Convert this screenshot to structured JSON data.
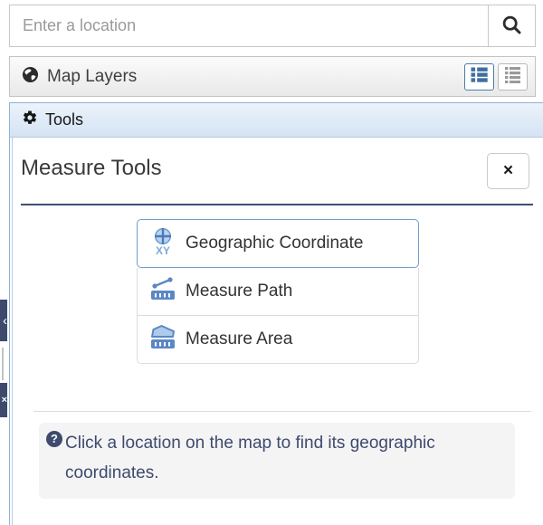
{
  "search": {
    "placeholder": "Enter a location"
  },
  "layers_header": {
    "title": "Map Layers",
    "icon": "globe-icon",
    "view_toggles": [
      {
        "name": "detailed-list-view",
        "icon": "list-detailed-icon",
        "active": true
      },
      {
        "name": "compact-list-view",
        "icon": "list-compact-icon",
        "active": false
      }
    ]
  },
  "tools_header": {
    "title": "Tools",
    "icon": "gear-icon"
  },
  "measure_panel": {
    "title": "Measure Tools",
    "close_glyph": "×",
    "tool_buttons": [
      {
        "label": "Geographic Coordinate",
        "icon": "geographic-coordinate-icon",
        "active": true
      },
      {
        "label": "Measure Path",
        "icon": "measure-path-icon",
        "active": false
      },
      {
        "label": "Measure Area",
        "icon": "measure-area-icon",
        "active": false
      }
    ],
    "help_text": "Click a location on the map to find its geographic coordinates.",
    "help_icon_glyph": "?"
  },
  "edge_controls": {
    "collapse_tab_glyph": "‹",
    "close_tab_glyph": "×"
  },
  "colors": {
    "accent_blue_border": "#4c7bab",
    "tool_icon_blue": "#5b87c5",
    "tool_icon_blue_light": "#aecbe9",
    "navy_text": "#3e4a6e",
    "hr_navy": "#3d4e77",
    "tools_header_top": "#ecf3fb",
    "tools_header_bottom": "#d4e3f4"
  }
}
